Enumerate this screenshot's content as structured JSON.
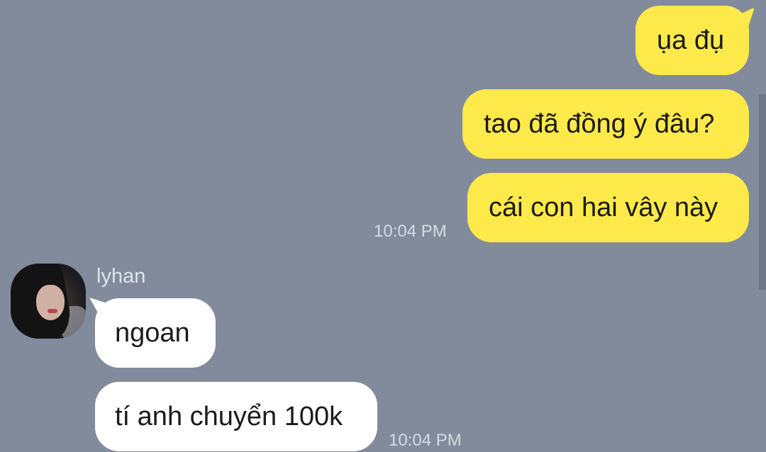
{
  "messages_outgoing": [
    {
      "text": "ụa đụ"
    },
    {
      "text": "tao đã đồng ý đâu?"
    },
    {
      "text": "cái con hai vây này"
    }
  ],
  "outgoing_time": "10:04 PM",
  "incoming": {
    "sender_name": "lyhan",
    "messages": [
      {
        "text": "ngoan"
      },
      {
        "text": "tí anh chuyển 100k"
      }
    ],
    "time": "10:04 PM"
  },
  "colors": {
    "background": "#828b9c",
    "outgoing_bubble": "#fee94a",
    "incoming_bubble": "#ffffff",
    "timestamp": "#d6dae1"
  }
}
